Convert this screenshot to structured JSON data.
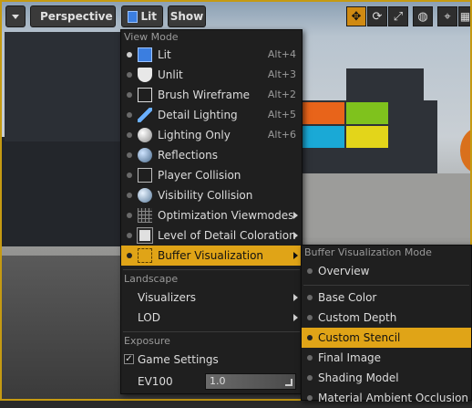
{
  "toolbar": {
    "perspective_label": "Perspective",
    "lit_label": "Lit",
    "show_label": "Show"
  },
  "menu": {
    "view_mode_header": "View Mode",
    "items": [
      {
        "label": "Lit",
        "shortcut": "Alt+4",
        "icon": "lit-sphere-icon"
      },
      {
        "label": "Unlit",
        "shortcut": "Alt+3",
        "icon": "unlit-shield-icon"
      },
      {
        "label": "Brush Wireframe",
        "shortcut": "Alt+2",
        "icon": "wireframe-cube-icon"
      },
      {
        "label": "Detail Lighting",
        "shortcut": "Alt+5",
        "icon": "brush-icon"
      },
      {
        "label": "Lighting Only",
        "shortcut": "Alt+6",
        "icon": "sphere-icon"
      },
      {
        "label": "Reflections",
        "shortcut": "",
        "icon": "reflection-sphere-icon"
      },
      {
        "label": "Player Collision",
        "shortcut": "",
        "icon": "collision-cube-icon"
      },
      {
        "label": "Visibility Collision",
        "shortcut": "",
        "icon": "visibility-sphere-icon"
      },
      {
        "label": "Optimization Viewmodes",
        "shortcut": "",
        "icon": "grid-icon"
      },
      {
        "label": "Level of Detail Coloration",
        "shortcut": "",
        "icon": "lod-icon"
      },
      {
        "label": "Buffer Visualization",
        "shortcut": "",
        "icon": "buffer-icon"
      }
    ],
    "landscape_header": "Landscape",
    "landscape_items": [
      "Visualizers",
      "LOD"
    ],
    "exposure_header": "Exposure",
    "game_settings_label": "Game Settings",
    "game_settings_checked": true,
    "ev100_label": "EV100",
    "ev100_value": "1.0"
  },
  "submenu": {
    "header": "Buffer Visualization Mode",
    "items": [
      "Overview",
      "Base Color",
      "Custom Depth",
      "Custom Stencil",
      "Final Image",
      "Shading Model",
      "Material Ambient Occlusion"
    ],
    "selected": "Custom Stencil"
  },
  "colors": {
    "accent": "#e0a417",
    "menu_bg": "#1f1f1f"
  }
}
